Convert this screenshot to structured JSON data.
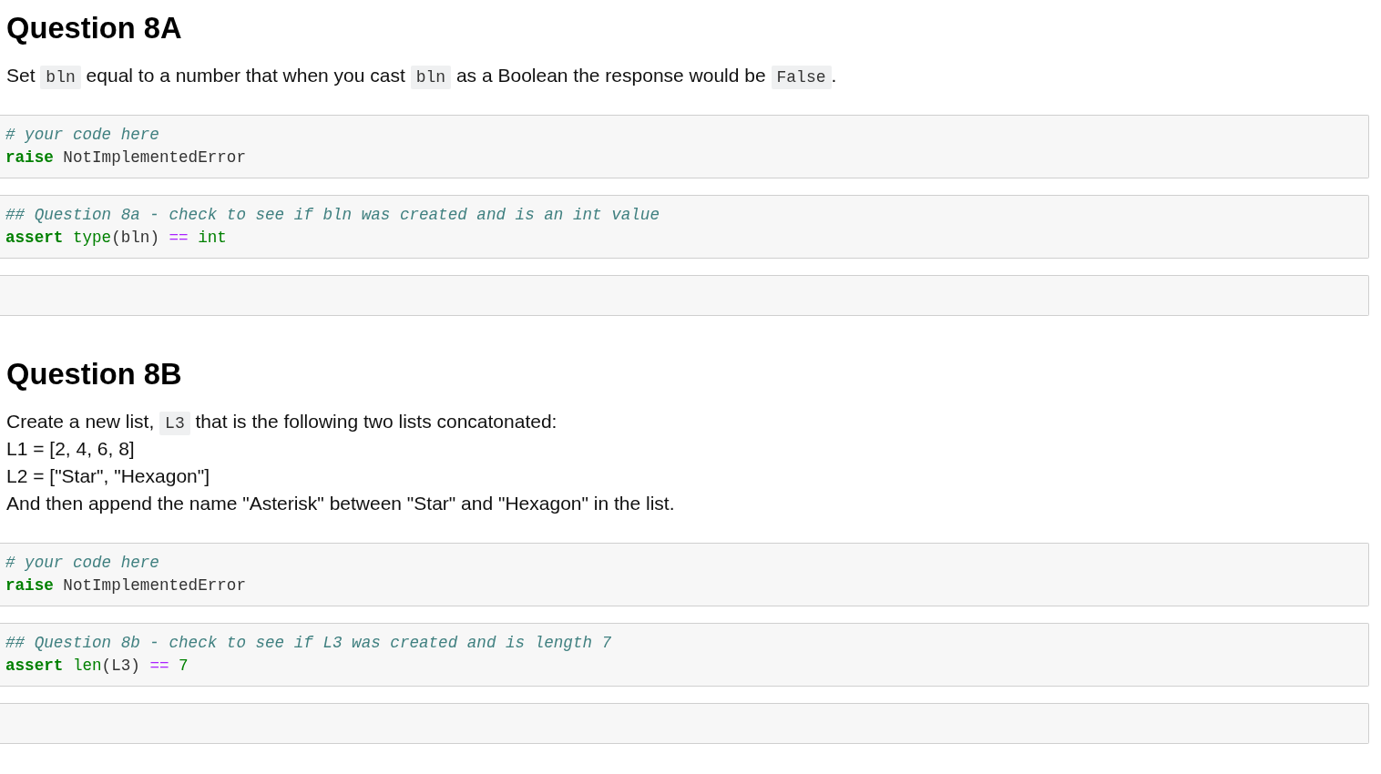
{
  "notebook": {
    "cells": [
      {
        "kind": "markdown",
        "heading": "Question 8A",
        "lines": [
          [
            {
              "kind": "text",
              "text": "Set "
            },
            {
              "kind": "code",
              "text": "bln"
            },
            {
              "kind": "text",
              "text": " equal to a number that when you cast "
            },
            {
              "kind": "code",
              "text": "bln"
            },
            {
              "kind": "text",
              "text": " as a Boolean the response would be "
            },
            {
              "kind": "code",
              "text": "False"
            },
            {
              "kind": "text",
              "text": "."
            }
          ]
        ]
      },
      {
        "kind": "code",
        "lines": [
          [
            {
              "kind": "comment",
              "text": "# your code here"
            }
          ],
          [
            {
              "kind": "keyword",
              "text": "raise"
            },
            {
              "kind": "name",
              "text": " NotImplementedError"
            }
          ]
        ]
      },
      {
        "kind": "code",
        "lines": [
          [
            {
              "kind": "comment",
              "text": "## Question 8a - check to see if bln was created and is an int value"
            }
          ],
          [
            {
              "kind": "keyword",
              "text": "assert"
            },
            {
              "kind": "builtin",
              "text": " type"
            },
            {
              "kind": "name",
              "text": "(bln) "
            },
            {
              "kind": "operator",
              "text": "=="
            },
            {
              "kind": "builtin",
              "text": " int"
            }
          ]
        ]
      },
      {
        "kind": "code"
      },
      {
        "kind": "markdown",
        "heading": "Question 8B",
        "lines": [
          [
            {
              "kind": "text",
              "text": "Create a new list, "
            },
            {
              "kind": "code",
              "text": "L3"
            },
            {
              "kind": "text",
              "text": " that is the following two lists concatonated:"
            }
          ],
          [
            {
              "kind": "text",
              "text": "L1 = [2, 4, 6, 8]"
            }
          ],
          [
            {
              "kind": "text",
              "text": "L2 = [\"Star\", \"Hexagon\"]"
            }
          ],
          [
            {
              "kind": "text",
              "text": "And then append the name \"Asterisk\" between \"Star\" and \"Hexagon\" in the list."
            }
          ]
        ]
      },
      {
        "kind": "code",
        "lines": [
          [
            {
              "kind": "comment",
              "text": "# your code here"
            }
          ],
          [
            {
              "kind": "keyword",
              "text": "raise"
            },
            {
              "kind": "name",
              "text": " NotImplementedError"
            }
          ]
        ]
      },
      {
        "kind": "code",
        "lines": [
          [
            {
              "kind": "comment",
              "text": "## Question 8b - check to see if L3 was created and is length 7"
            }
          ],
          [
            {
              "kind": "keyword",
              "text": "assert"
            },
            {
              "kind": "builtin",
              "text": " len"
            },
            {
              "kind": "name",
              "text": "(L3) "
            },
            {
              "kind": "operator",
              "text": "=="
            },
            {
              "kind": "number",
              "text": " 7"
            }
          ]
        ]
      },
      {
        "kind": "code"
      }
    ]
  }
}
